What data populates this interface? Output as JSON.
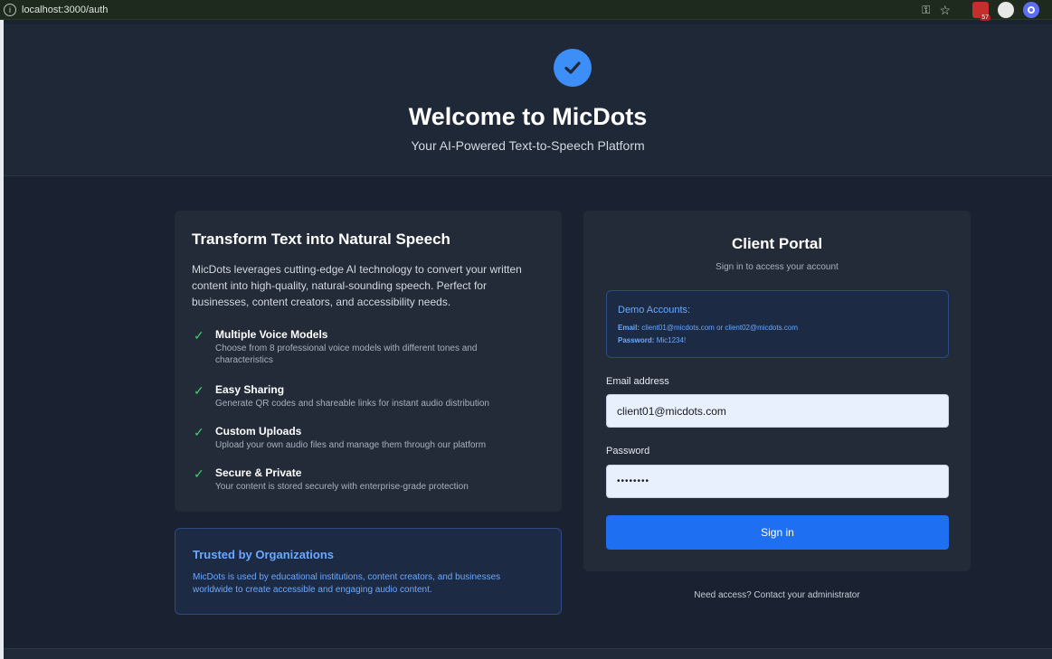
{
  "browser": {
    "url": "localhost:3000/auth",
    "extension_badge": "57"
  },
  "hero": {
    "title": "Welcome to MicDots",
    "subtitle": "Your AI-Powered Text-to-Speech Platform",
    "icon": "check-circle-icon",
    "accent_color": "#3e8ef7"
  },
  "features_card": {
    "title": "Transform Text into Natural Speech",
    "intro": "MicDots leverages cutting-edge AI technology to convert your written content into high-quality, natural-sounding speech. Perfect for businesses, content creators, and accessibility needs.",
    "features": [
      {
        "title": "Multiple Voice Models",
        "description": "Choose from 8 professional voice models with different tones and characteristics"
      },
      {
        "title": "Easy Sharing",
        "description": "Generate QR codes and shareable links for instant audio distribution"
      },
      {
        "title": "Custom Uploads",
        "description": "Upload your own audio files and manage them through our platform"
      },
      {
        "title": "Secure & Private",
        "description": "Your content is stored securely with enterprise-grade protection"
      }
    ]
  },
  "trusted_card": {
    "title": "Trusted by Organizations",
    "text": "MicDots is used by educational institutions, content creators, and businesses worldwide to create accessible and engaging audio content."
  },
  "login": {
    "title": "Client Portal",
    "subtitle": "Sign in to access your account",
    "demo": {
      "title": "Demo Accounts:",
      "email_label": "Email:",
      "email_value": "client01@micdots.com or client02@micdots.com",
      "password_label": "Password:",
      "password_value": "Mic1234!"
    },
    "email_label": "Email address",
    "email_value": "client01@micdots.com",
    "password_label": "Password",
    "password_value": "••••••••",
    "submit_label": "Sign in",
    "button_color": "#1f6ff2"
  },
  "footer_note": "Need access? Contact your administrator"
}
